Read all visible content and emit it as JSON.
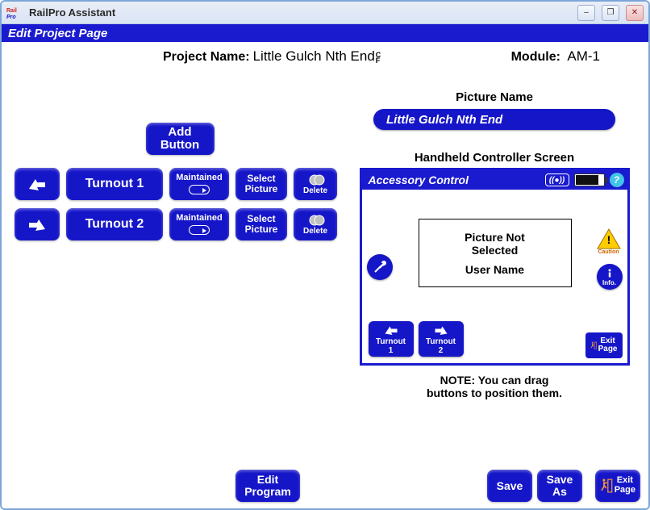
{
  "app": {
    "title": "RailPro Assistant"
  },
  "window_controls": {
    "minimize": "–",
    "maximize": "❐",
    "close": "✕"
  },
  "page": {
    "header": "Edit Project Page"
  },
  "project": {
    "name_label": "Project Name:",
    "name_value": "Little Gulch Nth End",
    "dirty_mark": "C\nF",
    "module_label": "Module:",
    "module_value": "AM-1"
  },
  "left": {
    "add_button": "Add\nButton",
    "rows": [
      {
        "turnout": "Turnout 1",
        "maintained": "Maintained",
        "select_picture": "Select\nPicture",
        "delete": "Delete"
      },
      {
        "turnout": "Turnout 2",
        "maintained": "Maintained",
        "select_picture": "Select\nPicture",
        "delete": "Delete"
      }
    ]
  },
  "right": {
    "picture_name_label": "Picture Name",
    "picture_name_value": "Little Gulch Nth End",
    "handheld_label": "Handheld Controller  Screen",
    "screen": {
      "title": "Accessory Control",
      "wifi_symbol": "((●))",
      "help_symbol": "?",
      "picture_not_selected_line1": "Picture Not",
      "picture_not_selected_line2": "Selected",
      "user_name": "User Name",
      "caution": "Caution",
      "info": "Info.",
      "turnout1": "Turnout 1",
      "turnout2": "Turnout 2",
      "exit_page": "Exit\nPage"
    },
    "note_line1": "NOTE: You can drag",
    "note_line2": "buttons to position them."
  },
  "footer": {
    "edit_program": "Edit\nProgram",
    "save": "Save",
    "save_as": "Save\nAs",
    "exit_page": "Exit\nPage"
  }
}
